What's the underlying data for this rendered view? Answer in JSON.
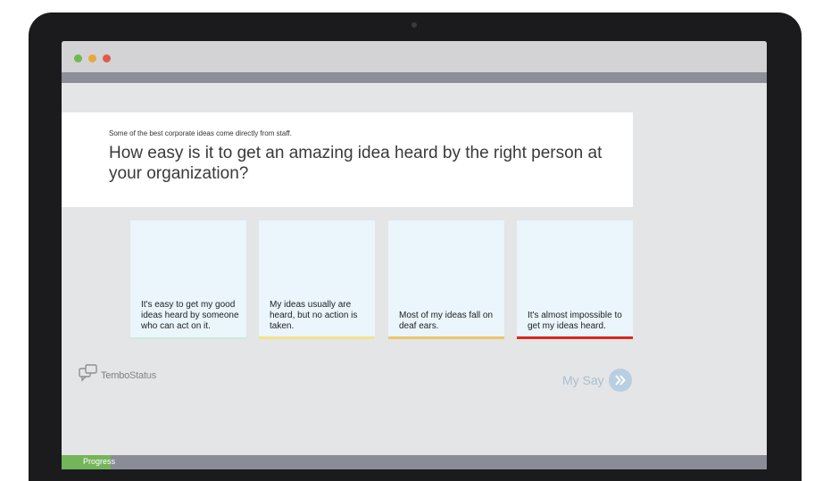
{
  "window": {
    "controls": [
      "close-dot-green",
      "minimize-dot-yellow",
      "maximize-dot-red"
    ]
  },
  "survey": {
    "intro": "Some of the best corporate ideas come directly from staff.",
    "question": "How easy is it to get an amazing idea heard by the right person at your organization?",
    "options": [
      {
        "label": "It's easy to get my good ideas heard by someone who can act on it.",
        "accent": "#cfe9dd"
      },
      {
        "label": "My ideas usually are heard, but no action is taken.",
        "accent": "#f3e28a"
      },
      {
        "label": "Most of my ideas fall on deaf ears.",
        "accent": "#efc46a"
      },
      {
        "label": "It's almost impossible to get my ideas heard.",
        "accent": "#e0261b"
      }
    ]
  },
  "brand": {
    "name_bold": "Tembo",
    "name_light": "Status",
    "icon": "chat-bubbles-icon"
  },
  "actions": {
    "my_say_label": "My Say",
    "my_say_icon": "double-chevron-right-icon"
  },
  "progress": {
    "label": "Progress",
    "value": 0.07
  },
  "colors": {
    "accent_blue": "#b7cfe0",
    "progress_green": "#74b55b",
    "card_bg": "#eaf5fc"
  }
}
